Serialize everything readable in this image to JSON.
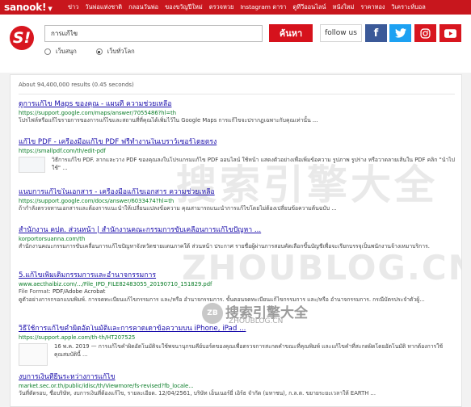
{
  "topbar": {
    "brand": "sanook!",
    "brand_caret": "▼",
    "nav": [
      "ข่าว",
      "วันพ่อแห่งชาติ",
      "กลอนวันพ่อ",
      "ของขวัญปีใหม่",
      "ตรวจหวย",
      "Instagram ดารา",
      "ดูทีวีออนไลน์",
      "หนังใหม่",
      "ราคาทอง",
      "วิเคราะห์บอล"
    ]
  },
  "header": {
    "logo_text": "S!",
    "search_value": "การแก้ไข",
    "search_button": "ค้นหา",
    "follow_label": "follow us",
    "social": {
      "facebook": "f",
      "twitter": "🐦",
      "instagram": "◎",
      "youtube": "▶"
    },
    "radios": [
      {
        "label": "เว็บสนุก",
        "checked": false
      },
      {
        "label": "เว็บทั่วโลก",
        "checked": true
      }
    ]
  },
  "results_stats": "About 94,400,000 results (0.45 seconds)",
  "results": [
    {
      "title": "ดูการแก้ไข Maps ของคุณ - แผนที่ ความช่วยเหลือ",
      "url": "https://support.google.com/maps/answer/7055486?hl=th",
      "snippet": "โปรไฟล์หรือแก้ไขรายการของการแก้ไขและสถานที่ที่คุณได้เพิ่มไว้ใน Google Maps การแก้ไขจะปรากฏเฉพาะกับคุณเท่านั้น ..."
    },
    {
      "title": "แก้ไข PDF - เครื่องมือแก้ไข PDF ฟรีทำงานในเบราว์เซอร์โดยตรง",
      "url": "https://smallpdf.com/th/edit-pdf",
      "snippet": "วิธีการแก้ไข PDF. ลากและวาง PDF ของคุณลงในโปรแกรมแก้ไข PDF ออนไลน์ ใช้หน้า แสดงตัวอย่างเพื่อเพิ่มข้อความ รูปภาพ รูปร่าง หรือวาดลายเส้นใน PDF คลิก \"นำไปใช้\" ..."
    },
    {
      "title": "แนบการแก้ไขในเอกสาร - เครื่องมือแก้ไขเอกสาร ความช่วยเหลือ",
      "url": "https://support.google.com/docs/answer/6033474?hl=th",
      "snippet": "ถ้ากำลังตรวจทานเอกสารและต้องการแนะนำให้เปลี่ยนแปลงข้อความ คุณสามารถแนะนำการแก้ไขโดยไม่ต้องเปลี่ยนข้อความต้นฉบับ ..."
    },
    {
      "title": "สำนักงาน คปต. ส่วนหน้า | สำนักงานคณะกรรมการขับเคลื่อนการแก้ไขปัญหา ...",
      "url": "korportorsuanna.com/th",
      "snippet": "สำนักงานคณะกรรมการขับเคลื่อนการแก้ไขปัญหาจังหวัดชายแดนภาคใต้ ส่วนหน้า ประกาศ รายชื่อผู้ผ่านการสอบคัดเลือกขึ้นบัญชีเพื่อจะเรียกบรรจุเป็นพนักงานจ้างเหมาบริการ."
    },
    {
      "title": "5.แก้ไขเพิ่มเติมกรรมการและอำนาจกรรมการ",
      "url": "www.aecthaibiz.com/.../File_IPD_FILE82483055_20190710_151829.pdf",
      "meta_label": "File Format:",
      "meta_value": "PDF/Adobe Acrobat",
      "snippet": "ดูตัวอย่างการกรอกแบบพิมพ์. การจดทะเบียนแก้ไขกรรมการ และ/หรือ อำนาจกรรมการ. ขั้นตอนจดทะเบียนแก้ไขกรรมการ และ/หรือ อำนาจกรรมการ. กรณีบัตรประจำตัวผู้..."
    },
    {
      "title": "วิธีใช้การแก้ไขคำผิดอัตโนมัติและการคาดเดาข้อความบน iPhone, iPad ...",
      "url": "https://support.apple.com/th-th/HT207525",
      "date": "16 พ.ค. 2019",
      "snippet": "การแก้ไขคำผิดอัตโนมัติจะใช้พจนานุกรมคีย์บอร์ดของคุณเพื่อตรวจการสะกดคำขณะที่คุณพิมพ์ และแก้ไขคำที่สะกดผิดโดยอัตโนมัติ หากต้องการใช้คุณสมบัตินี้ ..."
    },
    {
      "title": "งบการเงินที่ยื่นระหว่างการแก้ไข",
      "url": "market.sec.or.th/public/idisc/th/Viewmore/fs-revised?fb_locale...",
      "snippet": "วันที่ตัดรอบ, ชื่อบริษัท, งบการเงินที่ต้องแก้ไข, รายละเอียด. 12/04/2561, บริษัท เอ็นเนอร์ยี่ เอิร์ธ จำกัด (มหาชน), ก.ล.ต. ขยายระยะเวลาให้ EARTH ..."
    }
  ],
  "watermark": {
    "big_cn": "搜索引擎大全",
    "big_en": "ZHOUBLOG.CN",
    "badge": "ZB",
    "small_cn": "搜索引擎大全",
    "small_en": "ZHOUBLOG.CN"
  }
}
